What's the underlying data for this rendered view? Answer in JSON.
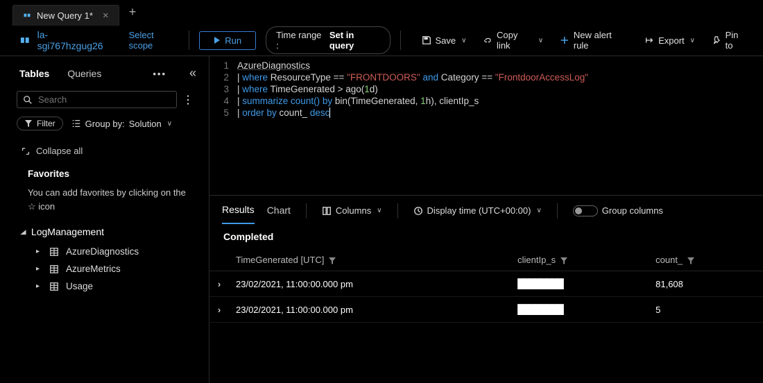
{
  "tab_title": "New Query 1*",
  "workspace_name": "la-sgi767hzgug26",
  "scope_link": "Select scope",
  "toolbar": {
    "run_label": "Run",
    "time_range_label": "Time range :",
    "time_range_value": "Set in query",
    "save_label": "Save",
    "copy_label": "Copy link",
    "alert_label": "New alert rule",
    "export_label": "Export",
    "pin_label": "Pin to"
  },
  "sidebar": {
    "tabs": {
      "tables": "Tables",
      "queries": "Queries"
    },
    "search_placeholder": "Search",
    "filter_label": "Filter",
    "group_by_prefix": "Group by:",
    "group_by_value": "Solution",
    "collapse_all": "Collapse all",
    "favorites_heading": "Favorites",
    "favorites_note_pre": "You can add favorites by clicking on the ",
    "favorites_note_post": " icon",
    "group_label": "LogManagement",
    "items": [
      "AzureDiagnostics",
      "AzureMetrics",
      "Usage"
    ]
  },
  "editor": {
    "lines": [
      [
        "AzureDiagnostics"
      ],
      [
        "| ",
        "where",
        " ResourceType ",
        "==",
        " ",
        "\"FRONTDOORS\"",
        " ",
        "and",
        " Category ",
        "==",
        " ",
        "\"FrontdoorAccessLog\""
      ],
      [
        "| ",
        "where",
        " TimeGenerated ",
        ">",
        " ago(",
        "1",
        "d)"
      ],
      [
        "| ",
        "summarize",
        " ",
        "count()",
        " ",
        "by",
        " bin(TimeGenerated, ",
        "1",
        "h), clientIp_s"
      ],
      [
        "| ",
        "order by",
        " count_ ",
        "desc"
      ]
    ]
  },
  "results_bar": {
    "tabs": {
      "results": "Results",
      "chart": "Chart"
    },
    "columns_label": "Columns",
    "display_time_label": "Display time (UTC+00:00)",
    "group_cols_label": "Group columns"
  },
  "status_text": "Completed",
  "table": {
    "headers": [
      "TimeGenerated [UTC]",
      "clientIp_s",
      "count_"
    ],
    "rows": [
      {
        "ts": "23/02/2021, 11:00:00.000 pm",
        "ip": "████████",
        "count": "81,608"
      },
      {
        "ts": "23/02/2021, 11:00:00.000 pm",
        "ip": "████████",
        "count": "5"
      }
    ]
  }
}
